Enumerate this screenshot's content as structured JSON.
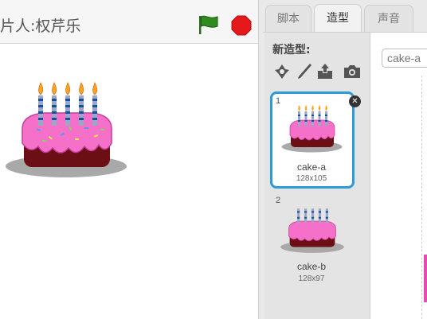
{
  "stage": {
    "title": "片人:权芹乐",
    "icons": {
      "flag": "green-flag-icon",
      "stop": "stop-icon"
    },
    "colors": {
      "flag": "#2f8a1f",
      "stop": "#e3191b"
    }
  },
  "tabs": [
    {
      "label": "脚本",
      "active": false
    },
    {
      "label": "造型",
      "active": true
    },
    {
      "label": "声音",
      "active": false
    }
  ],
  "costumes": {
    "new_label": "新造型:",
    "tools": [
      "paint-sprite-icon",
      "paintbrush-icon",
      "upload-icon",
      "camera-icon"
    ],
    "items": [
      {
        "number": "1",
        "name": "cake-a",
        "size": "128x105",
        "selected": true
      },
      {
        "number": "2",
        "name": "cake-b",
        "size": "128x97",
        "selected": false
      }
    ],
    "selected_color": "#2d9bd8"
  },
  "editor": {
    "name_value": "cake-a"
  }
}
